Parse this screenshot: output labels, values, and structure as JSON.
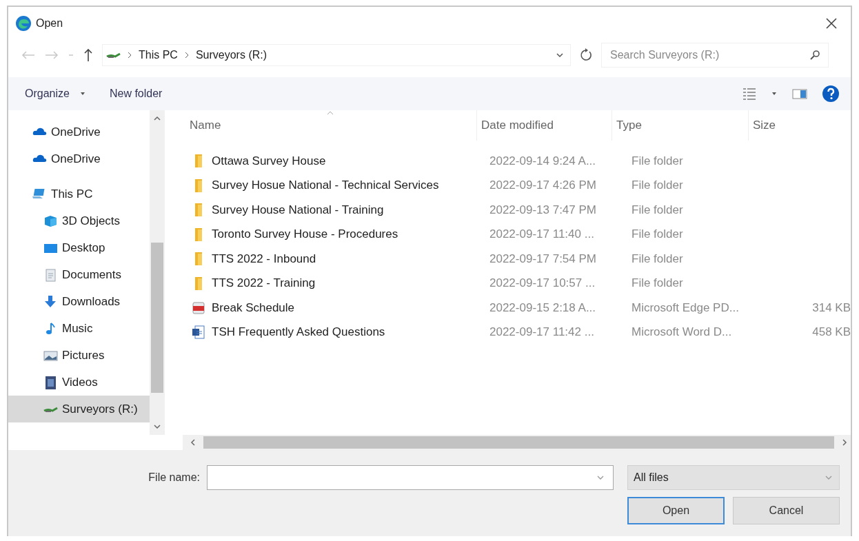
{
  "window": {
    "title": "Open"
  },
  "nav": {
    "path": [
      "This PC",
      "Surveyors (R:)"
    ],
    "search_placeholder": "Search Surveyors (R:)"
  },
  "toolbar": {
    "organize": "Organize",
    "new_folder": "New folder"
  },
  "sidebar": {
    "items": [
      {
        "label": "OneDrive",
        "kind": "cloud",
        "selected": false
      },
      {
        "label": "OneDrive",
        "kind": "cloud",
        "selected": false
      },
      {
        "label": "This PC",
        "kind": "computer",
        "selected": false,
        "children": [
          {
            "label": "3D Objects",
            "kind": "cube",
            "selected": false
          },
          {
            "label": "Desktop",
            "kind": "desktop",
            "selected": false
          },
          {
            "label": "Documents",
            "kind": "document",
            "selected": false
          },
          {
            "label": "Downloads",
            "kind": "download",
            "selected": false
          },
          {
            "label": "Music",
            "kind": "music",
            "selected": false
          },
          {
            "label": "Pictures",
            "kind": "pictures",
            "selected": false
          },
          {
            "label": "Videos",
            "kind": "videos",
            "selected": false
          },
          {
            "label": "Surveyors (R:)",
            "kind": "drive",
            "selected": true
          }
        ]
      }
    ]
  },
  "table": {
    "columns": [
      "Name",
      "Date modified",
      "Type",
      "Size"
    ],
    "rows": [
      {
        "kind": "folder",
        "name": "Ottawa Survey House",
        "date": "2022-09-14 9:24 A...",
        "type": "File folder"
      },
      {
        "kind": "folder",
        "name": "Survey Hosue National - Technical Services",
        "date": "2022-09-17 4:26 PM",
        "type": "File folder"
      },
      {
        "kind": "folder",
        "name": "Survey House National - Training",
        "date": "2022-09-13 7:47 PM",
        "type": "File folder"
      },
      {
        "kind": "folder",
        "name": "Toronto Survey House - Procedures",
        "date": "2022-09-17 11:40 ...",
        "type": "File folder"
      },
      {
        "kind": "folder",
        "name": "TTS 2022 - Inbound",
        "date": "2022-09-17 7:54 PM",
        "type": "File folder"
      },
      {
        "kind": "folder",
        "name": "TTS 2022 - Training",
        "date": "2022-09-17 10:57 ...",
        "type": "File folder"
      },
      {
        "kind": "pdf",
        "name": "Break Schedule",
        "date": "2022-09-15 2:18 A...",
        "type": "Microsoft Edge PD...",
        "size": "314 KB"
      },
      {
        "kind": "word",
        "name": "TSH Frequently Asked Questions",
        "date": "2022-09-17 11:42 ...",
        "type": "Microsoft Word D...",
        "size": "458 KB"
      }
    ]
  },
  "footer": {
    "file_name_label": "File name:",
    "filter": "All files",
    "buttons": [
      {
        "label": "Open",
        "kind": "primary"
      },
      {
        "label": "Cancel",
        "kind": "normal"
      }
    ]
  }
}
